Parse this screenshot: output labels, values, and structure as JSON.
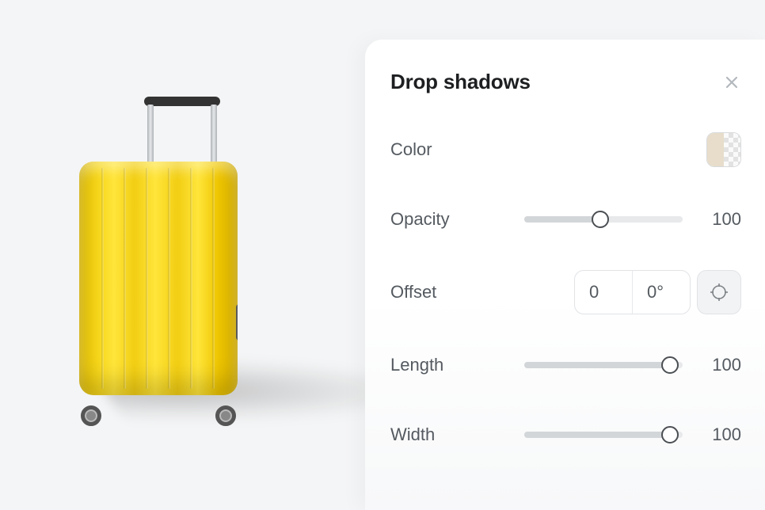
{
  "panel": {
    "title": "Drop shadows",
    "color": {
      "label": "Color",
      "swatch_hex": "#e7ddca"
    },
    "opacity": {
      "label": "Opacity",
      "value": "100",
      "percent": 48
    },
    "offset": {
      "label": "Offset",
      "distance": "0",
      "angle": "0°"
    },
    "length": {
      "label": "Length",
      "value": "100",
      "percent": 92
    },
    "width": {
      "label": "Width",
      "value": "100",
      "percent": 92
    }
  }
}
